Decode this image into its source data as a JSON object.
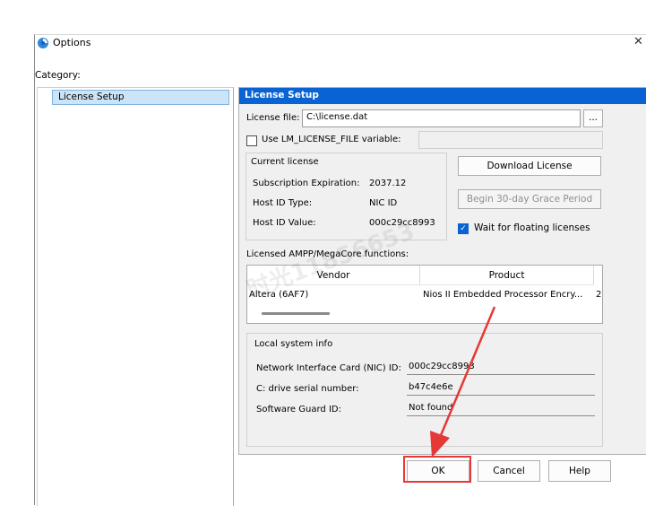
{
  "window": {
    "title": "Options",
    "close_glyph": "✕"
  },
  "category": {
    "label": "Category:",
    "items": [
      {
        "label": "License Setup",
        "selected": true
      }
    ]
  },
  "license_setup": {
    "header": "License Setup",
    "license_file_label": "License file:",
    "license_file_value": "C:\\license.dat",
    "browse_label": "...",
    "use_lm_label": "Use LM_LICENSE_FILE variable:",
    "use_lm_checked": false,
    "current_license": {
      "title": "Current license",
      "rows": [
        {
          "label": "Subscription Expiration:",
          "value": "2037.12"
        },
        {
          "label": "Host ID Type:",
          "value": "NIC ID"
        },
        {
          "label": "Host ID Value:",
          "value": "000c29cc8993"
        }
      ]
    },
    "download_button": "Download License",
    "grace_button": "Begin 30-day Grace Period",
    "wait_floating_label": "Wait for floating licenses",
    "wait_floating_checked": true,
    "functions_label": "Licensed AMPP/MegaCore functions:",
    "table": {
      "columns": [
        "Vendor",
        "Product"
      ],
      "rows": [
        {
          "vendor": "Altera (6AF7)",
          "product": "Nios II Embedded Processor Encry...",
          "extra": "2"
        }
      ]
    },
    "local_system": {
      "title": "Local system info",
      "rows": [
        {
          "label": "Network Interface Card (NIC) ID:",
          "value": "000c29cc8993"
        },
        {
          "label": "C: drive serial number:",
          "value": "b47c4e6e"
        },
        {
          "label": "Software Guard ID:",
          "value": "Not found"
        }
      ]
    }
  },
  "footer": {
    "ok": "OK",
    "cancel": "Cancel",
    "help": "Help"
  },
  "watermark": "时光11856653",
  "colors": {
    "accent": "#0a63d3",
    "annotation": "#e53935",
    "selection": "#cce4f7"
  }
}
